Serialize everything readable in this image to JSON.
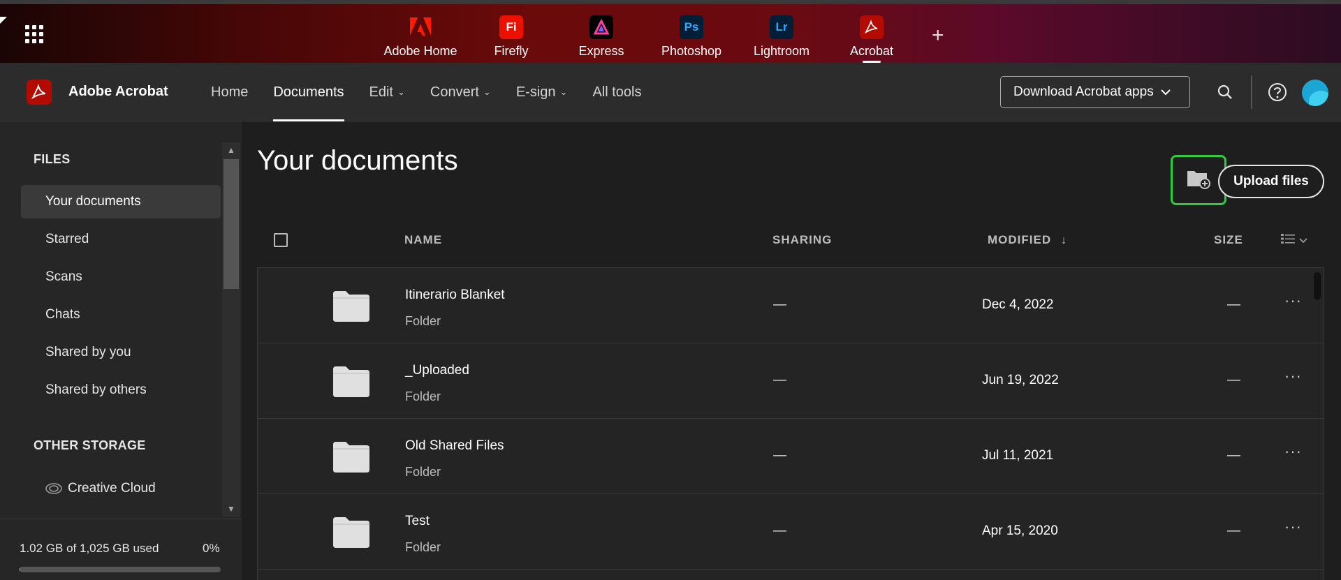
{
  "app_switcher": {
    "apps": [
      {
        "label": "Adobe Home",
        "icon": "adobe-logo-icon",
        "color": "#ff1a00"
      },
      {
        "label": "Firefly",
        "icon_text": "Fi",
        "color": "#eb1000"
      },
      {
        "label": "Express",
        "icon": "express-icon",
        "color": "#000000"
      },
      {
        "label": "Photoshop",
        "icon_text": "Ps",
        "color": "#001e36"
      },
      {
        "label": "Lightroom",
        "icon_text": "Lr",
        "color": "#001e36"
      },
      {
        "label": "Acrobat",
        "icon": "acrobat-icon",
        "color": "#b30b00",
        "active": true
      }
    ],
    "add_label": "+"
  },
  "header": {
    "brand": "Adobe Acrobat",
    "nav": [
      {
        "label": "Home"
      },
      {
        "label": "Documents",
        "active": true
      },
      {
        "label": "Edit",
        "dropdown": true
      },
      {
        "label": "Convert",
        "dropdown": true
      },
      {
        "label": "E-sign",
        "dropdown": true
      },
      {
        "label": "All tools"
      }
    ],
    "download_button": "Download Acrobat apps"
  },
  "sidebar": {
    "files_heading": "FILES",
    "items": [
      {
        "label": "Your documents",
        "selected": true
      },
      {
        "label": "Starred"
      },
      {
        "label": "Scans"
      },
      {
        "label": "Chats"
      },
      {
        "label": "Shared by you"
      },
      {
        "label": "Shared by others"
      }
    ],
    "other_heading": "OTHER STORAGE",
    "other_items": [
      {
        "label": "Creative Cloud",
        "icon": "creative-cloud-icon"
      }
    ],
    "storage": {
      "text": "1.02 GB of 1,025 GB used",
      "percent_label": "0%",
      "fraction": 0.001
    }
  },
  "main": {
    "title": "Your documents",
    "upload_button": "Upload files",
    "columns": {
      "name": "NAME",
      "sharing": "SHARING",
      "modified": "MODIFIED",
      "size": "SIZE"
    },
    "rows": [
      {
        "name": "Itinerario Blanket",
        "type": "Folder",
        "sharing": "—",
        "modified": "Dec 4, 2022",
        "size": "—"
      },
      {
        "name": "_Uploaded",
        "type": "Folder",
        "sharing": "—",
        "modified": "Jun 19, 2022",
        "size": "—"
      },
      {
        "name": "Old Shared Files",
        "type": "Folder",
        "sharing": "—",
        "modified": "Jul 11, 2021",
        "size": "—"
      },
      {
        "name": "Test",
        "type": "Folder",
        "sharing": "—",
        "modified": "Apr 15, 2020",
        "size": "—"
      }
    ],
    "more_label": "···"
  },
  "colors": {
    "highlight": "#2ecc40",
    "acrobat_red": "#b30b00"
  }
}
